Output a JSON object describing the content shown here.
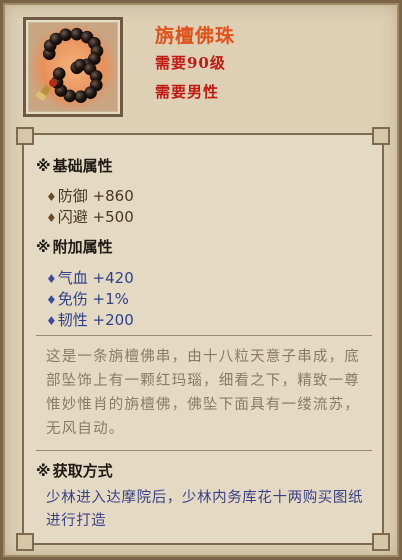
{
  "item": {
    "name": "旃檀佛珠",
    "requirement_level": "需要90级",
    "requirement_gender": "需要男性",
    "icon": "prayer-beads-icon"
  },
  "basic_attributes": {
    "title": "基础属性",
    "marker": "※",
    "items": [
      {
        "bullet": "♦",
        "text": "防御 +860"
      },
      {
        "bullet": "♦",
        "text": "闪避 +500"
      }
    ]
  },
  "extra_attributes": {
    "title": "附加属性",
    "marker": "※",
    "items": [
      {
        "bullet": "♦",
        "text": "气血 +420"
      },
      {
        "bullet": "♦",
        "text": "免伤 +1%"
      },
      {
        "bullet": "♦",
        "text": "韧性 +200"
      }
    ]
  },
  "description": "这是一条旃檀佛串，由十八粒天意子串成，底部坠饰上有一颗红玛瑙，细看之下，精致一尊惟妙惟肖的旃檀佛，佛坠下面具有一缕流苏，无风自动。",
  "obtain": {
    "title": "获取方式",
    "marker": "※",
    "text": "少林进入达摩院后，少林内务库花十两购买图纸进行打造"
  },
  "colors": {
    "name": "#e0521a",
    "requirement": "#c11a12",
    "extra_attr": "#2f3f8c",
    "description": "#8a7a65"
  }
}
